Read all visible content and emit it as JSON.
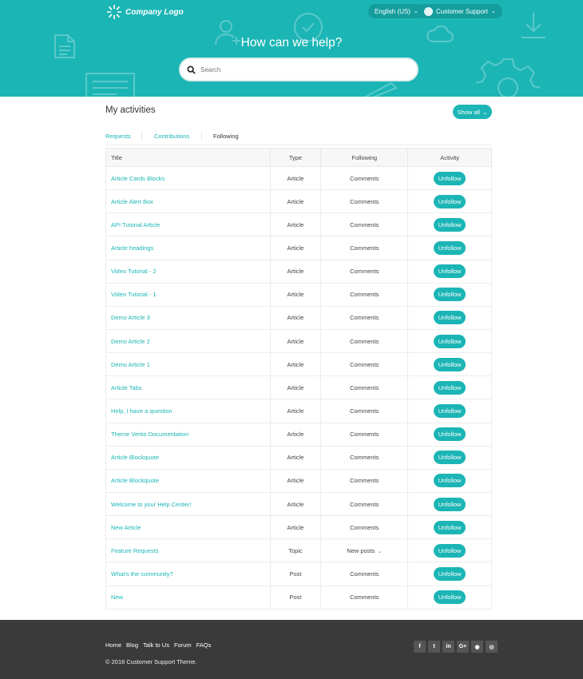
{
  "header": {
    "logo_text": "Company Logo",
    "language": "English (US)",
    "user": "Customer Support",
    "title": "How can we help?",
    "search_placeholder": "Search",
    "accent_color": "#1cb5b5"
  },
  "activities": {
    "title": "My activities",
    "show_all": "Show all",
    "tabs": [
      "Requests",
      "Contributions",
      "Following"
    ],
    "active_tab": "Following",
    "columns": [
      "Title",
      "Type",
      "Following",
      "Activity"
    ],
    "action_label": "Unfollow",
    "rows": [
      {
        "title": "Article Cards Blocks",
        "type": "Article",
        "following": "Comments"
      },
      {
        "title": "Article Alert Box",
        "type": "Article",
        "following": "Comments"
      },
      {
        "title": "API Tutorial Article",
        "type": "Article",
        "following": "Comments"
      },
      {
        "title": "Article headings",
        "type": "Article",
        "following": "Comments"
      },
      {
        "title": "Video Tutorial - 2",
        "type": "Article",
        "following": "Comments"
      },
      {
        "title": "Video Tutorial - 1",
        "type": "Article",
        "following": "Comments"
      },
      {
        "title": "Demo Article 3",
        "type": "Article",
        "following": "Comments"
      },
      {
        "title": "Demo Article 2",
        "type": "Article",
        "following": "Comments"
      },
      {
        "title": "Demo Article 1",
        "type": "Article",
        "following": "Comments"
      },
      {
        "title": "Article Tabs",
        "type": "Article",
        "following": "Comments"
      },
      {
        "title": "Help, I have a question",
        "type": "Article",
        "following": "Comments"
      },
      {
        "title": "Theme Vertio Documentation",
        "type": "Article",
        "following": "Comments"
      },
      {
        "title": "Article Blockquote",
        "type": "Article",
        "following": "Comments"
      },
      {
        "title": "Article Blockquote",
        "type": "Article",
        "following": "Comments"
      },
      {
        "title": "Welcome to your Help Center!",
        "type": "Article",
        "following": "Comments"
      },
      {
        "title": "New Article",
        "type": "Article",
        "following": "Comments"
      },
      {
        "title": "Feature Requests",
        "type": "Topic",
        "following": "New posts",
        "dropdown": true
      },
      {
        "title": "What's the community?",
        "type": "Post",
        "following": "Comments"
      },
      {
        "title": "New",
        "type": "Post",
        "following": "Comments"
      }
    ]
  },
  "footer": {
    "links": [
      "Home",
      "Blog",
      "Talk to Us",
      "Forum",
      "FAQs"
    ],
    "copyright": "© 2016 Customer Support Theme.",
    "social": [
      {
        "icon": "facebook-icon",
        "glyph": "f"
      },
      {
        "icon": "twitter-icon",
        "glyph": "t"
      },
      {
        "icon": "linkedin-icon",
        "glyph": "in"
      },
      {
        "icon": "google-plus-icon",
        "glyph": "G+"
      },
      {
        "icon": "github-icon",
        "glyph": "◉"
      },
      {
        "icon": "instagram-icon",
        "glyph": "◎"
      }
    ]
  }
}
